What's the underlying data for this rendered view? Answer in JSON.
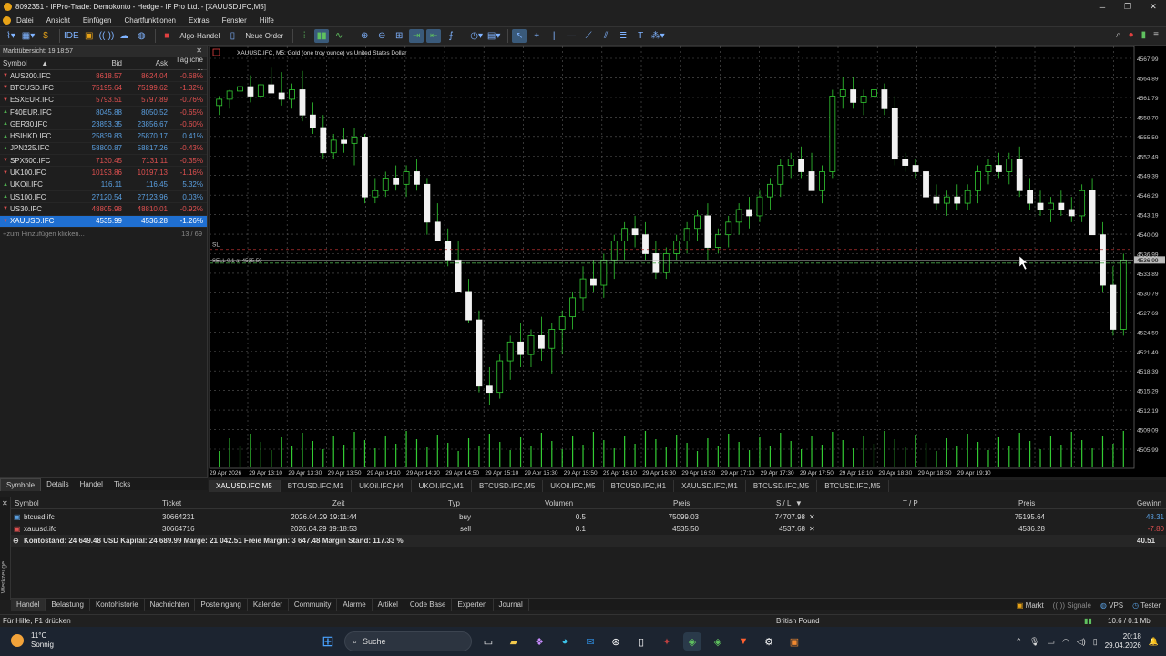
{
  "window": {
    "title": "8092351 - IFPro-Trade: Demokonto - Hedge - IF Pro Ltd. - [XAUUSD.IFC,M5]"
  },
  "menu": [
    "Datei",
    "Ansicht",
    "Einfügen",
    "Chartfunktionen",
    "Extras",
    "Fenster",
    "Hilfe"
  ],
  "toolbar": {
    "algo": "Algo-Handel",
    "new_order": "Neue Order"
  },
  "market_watch": {
    "header": "Marktübersicht: 19:18:57",
    "cols": {
      "symbol": "Symbol",
      "bid": "Bid",
      "ask": "Ask",
      "chg": "Tägliche ..."
    },
    "rows": [
      {
        "symbol": "AUS200.IFC",
        "bid": "8618.57",
        "ask": "8624.04",
        "chg": "-0.68%",
        "dir": "dn"
      },
      {
        "symbol": "BTCUSD.IFC",
        "bid": "75195.64",
        "ask": "75199.62",
        "chg": "-1.32%",
        "dir": "dn"
      },
      {
        "symbol": "ESXEUR.IFC",
        "bid": "5793.51",
        "ask": "5797.89",
        "chg": "-0.76%",
        "dir": "dn"
      },
      {
        "symbol": "F40EUR.IFC",
        "bid": "8045.88",
        "ask": "8050.52",
        "chg": "-0.65%",
        "dir": "up"
      },
      {
        "symbol": "GER30.IFC",
        "bid": "23853.35",
        "ask": "23856.67",
        "chg": "-0.60%",
        "dir": "up"
      },
      {
        "symbol": "HSIHKD.IFC",
        "bid": "25839.83",
        "ask": "25870.17",
        "chg": "0.41%",
        "dir": "up"
      },
      {
        "symbol": "JPN225.IFC",
        "bid": "58800.87",
        "ask": "58817.26",
        "chg": "-0.43%",
        "dir": "up"
      },
      {
        "symbol": "SPX500.IFC",
        "bid": "7130.45",
        "ask": "7131.11",
        "chg": "-0.35%",
        "dir": "dn"
      },
      {
        "symbol": "UK100.IFC",
        "bid": "10193.86",
        "ask": "10197.13",
        "chg": "-1.16%",
        "dir": "dn"
      },
      {
        "symbol": "UKOil.IFC",
        "bid": "116.11",
        "ask": "116.45",
        "chg": "5.32%",
        "dir": "up"
      },
      {
        "symbol": "US100.IFC",
        "bid": "27120.54",
        "ask": "27123.96",
        "chg": "0.03%",
        "dir": "up"
      },
      {
        "symbol": "US30.IFC",
        "bid": "48805.98",
        "ask": "48810.01",
        "chg": "-0.92%",
        "dir": "dn"
      },
      {
        "symbol": "XAUUSD.IFC",
        "bid": "4535.99",
        "ask": "4536.28",
        "chg": "-1.26%",
        "dir": "dn"
      }
    ],
    "add_label": "zum Hinzufügen klicken...",
    "count": "13 / 69",
    "tabs": [
      "Symbole",
      "Details",
      "Handel",
      "Ticks"
    ]
  },
  "chart": {
    "label": "XAUUSD.IFC, M5:  Gold (one troy ounce) vs United States Dollar",
    "sl_label": "SL",
    "sell_label": "SELL 0.1 at 4535.50",
    "price_ticks": [
      "4567.99",
      "4564.89",
      "4561.79",
      "4558.70",
      "4555.59",
      "4552.49",
      "4549.39",
      "4546.29",
      "4543.19",
      "4540.09",
      "4536.99",
      "4533.89",
      "4530.79",
      "4527.69",
      "4524.59",
      "4521.49",
      "4518.39",
      "4515.29",
      "4512.19",
      "4509.09",
      "4505.99"
    ],
    "current_price": "4536.99",
    "time_ticks": [
      "29 Apr 2026",
      "29 Apr 13:10",
      "29 Apr 13:30",
      "29 Apr 13:50",
      "29 Apr 14:10",
      "29 Apr 14:30",
      "29 Apr 14:50",
      "29 Apr 15:10",
      "29 Apr 15:30",
      "29 Apr 15:50",
      "29 Apr 16:10",
      "29 Apr 16:30",
      "29 Apr 16:50",
      "29 Apr 17:10",
      "29 Apr 17:30",
      "29 Apr 17:50",
      "29 Apr 18:10",
      "29 Apr 18:30",
      "29 Apr 18:50",
      "29 Apr 19:10"
    ],
    "tabs": [
      "XAUUSD.IFC,M5",
      "BTCUSD.IFC,M1",
      "UKOil.IFC,H4",
      "UKOil.IFC,M1",
      "BTCUSD.IFC,M5",
      "UKOil.IFC,M5",
      "BTCUSD.IFC,H1",
      "XAUUSD.IFC,M1",
      "BTCUSD.IFC,M5",
      "BTCUSD.IFC,M5"
    ]
  },
  "terminal": {
    "cols": {
      "symbol": "Symbol",
      "ticket": "Ticket",
      "time": "Zeit",
      "type": "Typ",
      "volume": "Volumen",
      "price": "Preis",
      "sl": "S / L",
      "tp": "T / P",
      "cur_price": "Preis",
      "profit": "Gewinn"
    },
    "rows": [
      {
        "symbol": "btcusd.ifc",
        "ticket": "30664231",
        "time": "2026.04.29 19:11:44",
        "type": "buy",
        "volume": "0.5",
        "price": "75099.03",
        "sl": "74707.98",
        "tp": "",
        "cur_price": "75195.64",
        "profit": "48.31"
      },
      {
        "symbol": "xauusd.ifc",
        "ticket": "30664716",
        "time": "2026.04.29 19:18:53",
        "type": "sell",
        "volume": "0.1",
        "price": "4535.50",
        "sl": "4537.68",
        "tp": "",
        "cur_price": "4536.28",
        "profit": "-7.80"
      }
    ],
    "summary": "Kontostand: 24 649.48 USD  Kapital: 24 689.99  Marge: 21 042.51  Freie Margin: 3 647.48  Margin Stand: 117.33 %",
    "total": "40.51",
    "side_label": "Werkzeuge",
    "tabs": [
      "Handel",
      "Belastung",
      "Kontohistorie",
      "Nachrichten",
      "Posteingang",
      "Kalender",
      "Community",
      "Alarme",
      "Artikel",
      "Code Base",
      "Experten",
      "Journal"
    ],
    "right": [
      "Markt",
      "Signale",
      "VPS",
      "Tester"
    ]
  },
  "status": {
    "help": "Für Hilfe, F1 drücken",
    "currency": "British Pound",
    "traffic": "10.6 / 0.1 Mb"
  },
  "taskbar": {
    "temp": "11°C",
    "weather": "Sonnig",
    "search": "Suche",
    "time": "20:18",
    "date": "29.04.2026"
  }
}
